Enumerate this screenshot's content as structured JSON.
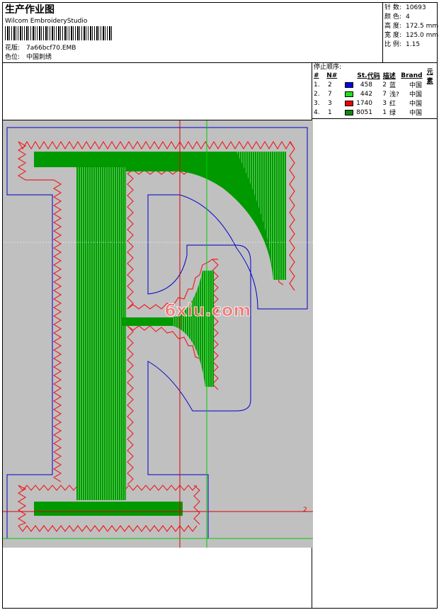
{
  "header": {
    "title": "生产作业图",
    "software": "Wilcom EmbroideryStudio",
    "pattern_label": "花版:",
    "pattern_value": "7a66bcf70.EMB",
    "color_label": "色位:",
    "color_value": "中国刺绣"
  },
  "stats": [
    {
      "label": "针 数:",
      "value": "10693"
    },
    {
      "label": "颜 色:",
      "value": "4"
    },
    {
      "label": "高 度:",
      "value": "172.5 mm"
    },
    {
      "label": "宽 度:",
      "value": "125.0 mm"
    },
    {
      "label": "比 例:",
      "value": "1.15"
    }
  ],
  "stop_sequence": {
    "title": "停止顺序:",
    "headers": [
      "#",
      "N#",
      "St.",
      "代码",
      "描述",
      "Brand",
      "元素"
    ],
    "rows": [
      {
        "idx": "1.",
        "no": "2",
        "color": "#0000ee",
        "stitches": "458",
        "code": "2",
        "desc": "蓝",
        "brand": "中国"
      },
      {
        "idx": "2.",
        "no": "7",
        "color": "#22dd22",
        "stitches": "442",
        "code": "7",
        "desc": "浅?",
        "brand": "中国"
      },
      {
        "idx": "3.",
        "no": "3",
        "color": "#ee0000",
        "stitches": "1740",
        "code": "3",
        "desc": "红",
        "brand": "中国"
      },
      {
        "idx": "4.",
        "no": "1",
        "color": "#118811",
        "stitches": "8051",
        "code": "1",
        "desc": "绿",
        "brand": "中国"
      }
    ]
  },
  "design": {
    "watermark": "6xiu.com",
    "marker_label": "2",
    "colors": {
      "background": "#c0c0c0",
      "fill": "#009900",
      "satin": "#ee2222",
      "outline": "#0000cc",
      "guide_red": "#dd0000",
      "guide_green": "#00cc00"
    }
  }
}
